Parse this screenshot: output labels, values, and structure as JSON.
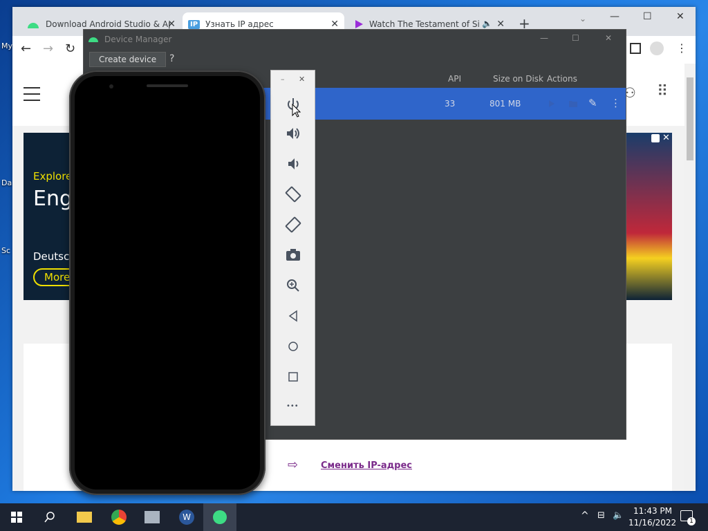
{
  "browser": {
    "tabs": [
      {
        "title": "Download Android Studio & Ap"
      },
      {
        "title": "Узнать IP адрес"
      },
      {
        "title": "Watch The Testament of Sist"
      }
    ],
    "new_tab": "+"
  },
  "desktop": {
    "icons": [
      "My",
      "Da",
      "Sc"
    ]
  },
  "page": {
    "ad_explore": "Explore",
    "ad_eng": "Eng",
    "ad_deutsche": "Deutsc",
    "ad_more": "More",
    "change_ip": "Сменить IP-адрес"
  },
  "device_manager": {
    "title": "Device Manager",
    "create_device": "Create device",
    "help": "?",
    "columns": {
      "api": "API",
      "size": "Size on Disk",
      "actions": "Actions"
    },
    "row": {
      "api": "33",
      "size": "801 MB"
    }
  },
  "emulator": {
    "minimize": "–",
    "close": "✕",
    "more": "•••"
  },
  "taskbar": {
    "time": "11:43 PM",
    "date": "11/16/2022",
    "notifications": "1"
  },
  "colors": {
    "accent": "#2f65ca",
    "dm_bg": "#3c3f41",
    "link": "#7a2a8a"
  }
}
